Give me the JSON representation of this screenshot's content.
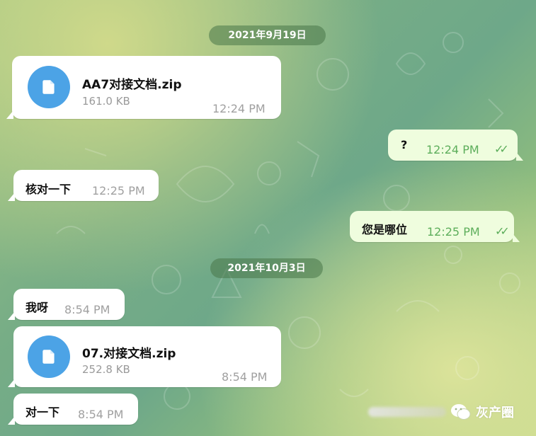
{
  "dates": [
    "2021年9月19日",
    "2021年10月3日"
  ],
  "messages": [
    {
      "type": "file",
      "name": "AA7对接文档.zip",
      "size": "161.0 KB",
      "time": "12:24 PM"
    },
    {
      "type": "text",
      "text": "?",
      "time": "12:24 PM",
      "outgoing": true
    },
    {
      "type": "text",
      "text": "核对一下",
      "time": "12:25 PM"
    },
    {
      "type": "text",
      "text": "您是哪位",
      "time": "12:25 PM",
      "outgoing": true
    },
    {
      "type": "text",
      "text": "我呀",
      "time": "8:54 PM"
    },
    {
      "type": "file",
      "name": "07.对接文档.zip",
      "size": "252.8 KB",
      "time": "8:54 PM"
    },
    {
      "type": "text",
      "text": "对一下",
      "time": "8:54 PM"
    }
  ],
  "watermark": {
    "text": "灰产圈"
  },
  "colors": {
    "file_icon": "#4ca3e6",
    "outgoing_bubble": "#effdde",
    "outgoing_time": "#5dae5b",
    "date_pill": "#487648"
  },
  "icons": {
    "file": "document-icon",
    "read": "double-check-icon",
    "wechat": "wechat-logo"
  }
}
